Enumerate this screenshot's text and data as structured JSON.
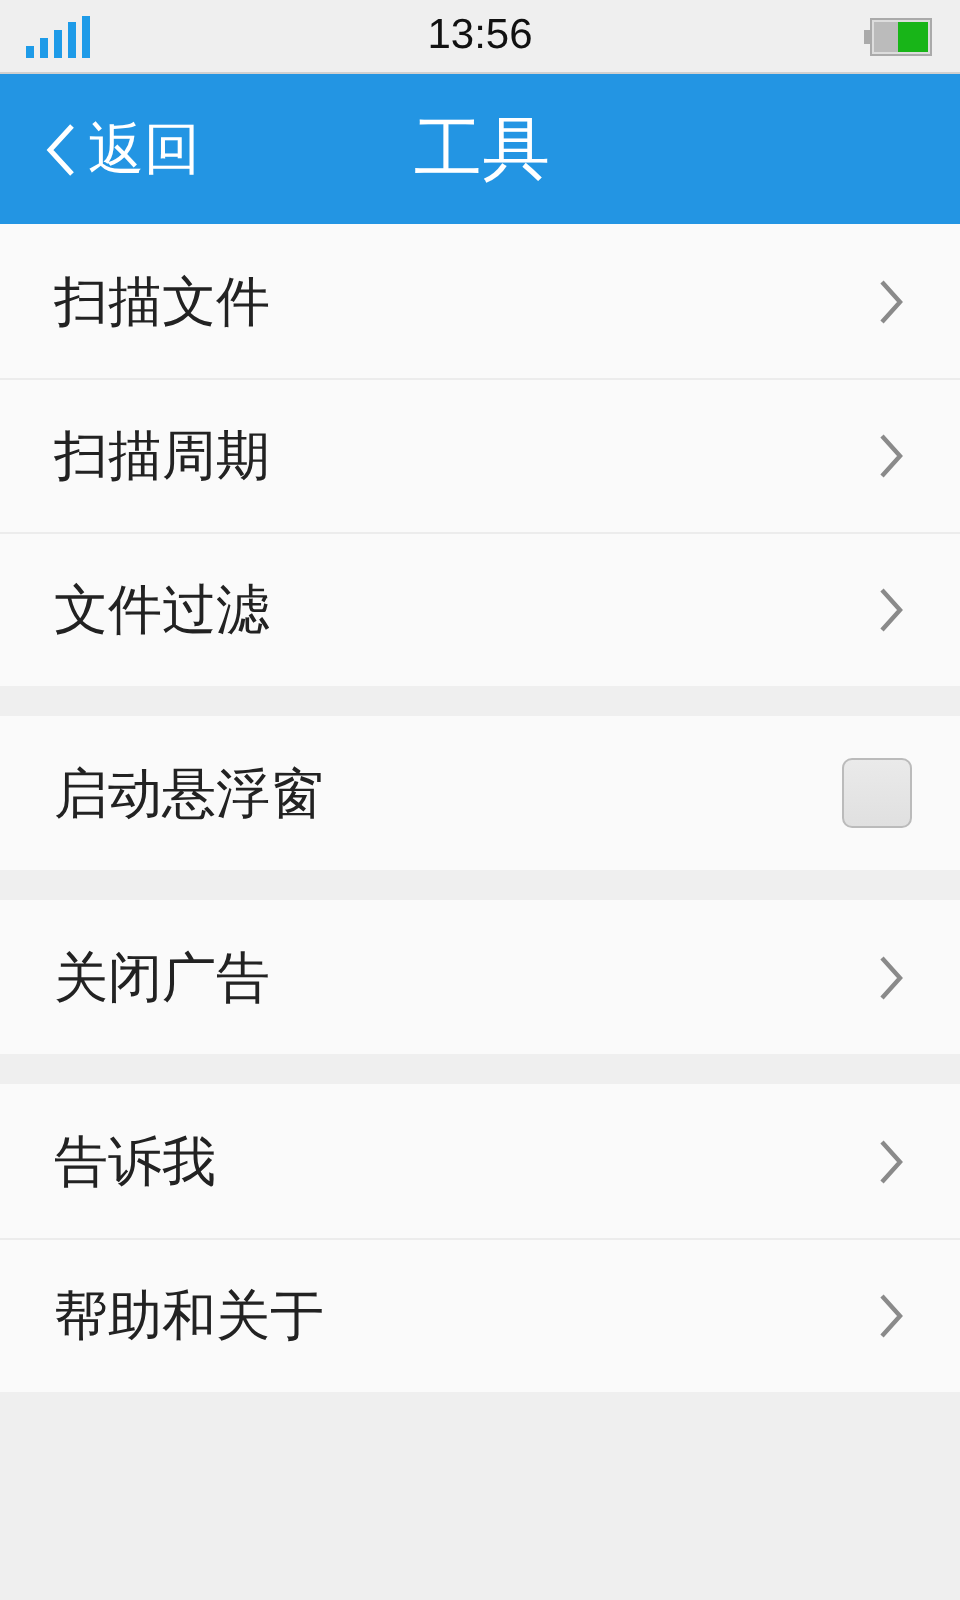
{
  "status_bar": {
    "time": "13:56"
  },
  "header": {
    "back": "返回",
    "title": "工具"
  },
  "groups": [
    {
      "items": [
        {
          "kind": "link",
          "label": "扫描文件"
        },
        {
          "kind": "link",
          "label": "扫描周期"
        },
        {
          "kind": "link",
          "label": "文件过滤"
        }
      ]
    },
    {
      "items": [
        {
          "kind": "checkbox",
          "label": "启动悬浮窗",
          "checked": false
        }
      ]
    },
    {
      "items": [
        {
          "kind": "link",
          "label": "关闭广告"
        }
      ]
    },
    {
      "items": [
        {
          "kind": "link",
          "label": "告诉我"
        },
        {
          "kind": "link",
          "label": "帮助和关于"
        }
      ]
    }
  ]
}
